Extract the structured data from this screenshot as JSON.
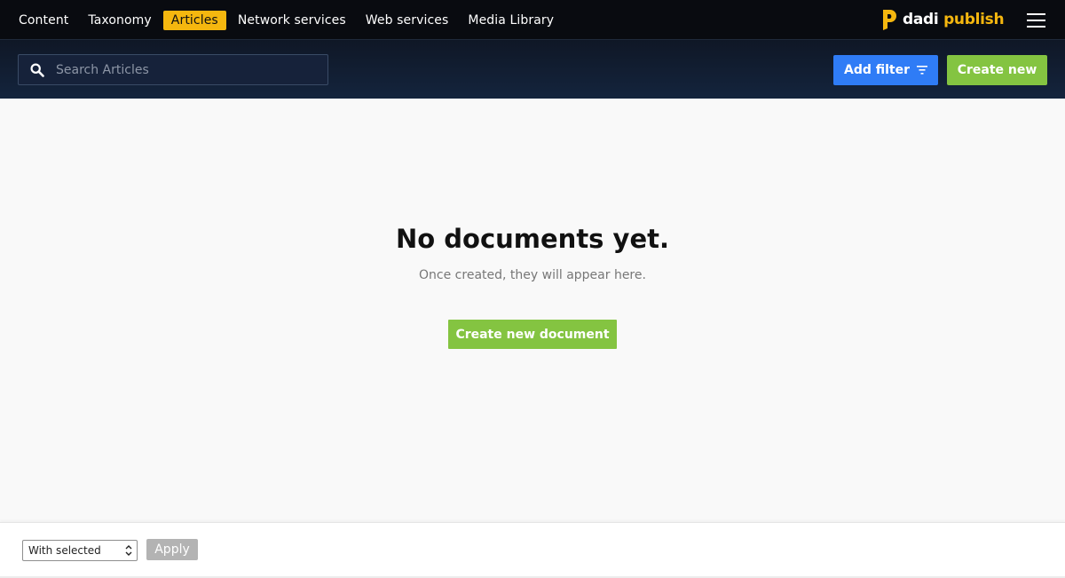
{
  "nav": {
    "items": [
      {
        "label": "Content",
        "active": false
      },
      {
        "label": "Taxonomy",
        "active": false
      },
      {
        "label": "Articles",
        "active": true
      },
      {
        "label": "Network services",
        "active": false
      },
      {
        "label": "Web services",
        "active": false
      },
      {
        "label": "Media Library",
        "active": false
      }
    ]
  },
  "brand": {
    "word1": "dadi",
    "word2": "publish"
  },
  "icons": {
    "search": "search-icon",
    "filter": "filter-icon",
    "menu": "hamburger-menu-icon",
    "logo": "dadi-logo-icon",
    "select": "select-arrows-icon"
  },
  "toolbar": {
    "search_placeholder": "Search Articles",
    "add_filter_label": "Add filter",
    "create_new_label": "Create new"
  },
  "empty_state": {
    "title": "No documents yet.",
    "subtitle": "Once created, they will appear here.",
    "button_label": "Create new document"
  },
  "footer": {
    "bulk_select_value": "With selected",
    "apply_label": "Apply"
  },
  "colors": {
    "accent_yellow": "#f5b70f",
    "filter_blue": "#2f7cf6",
    "create_green": "#84c441",
    "apply_gray": "#b3b3b3"
  }
}
